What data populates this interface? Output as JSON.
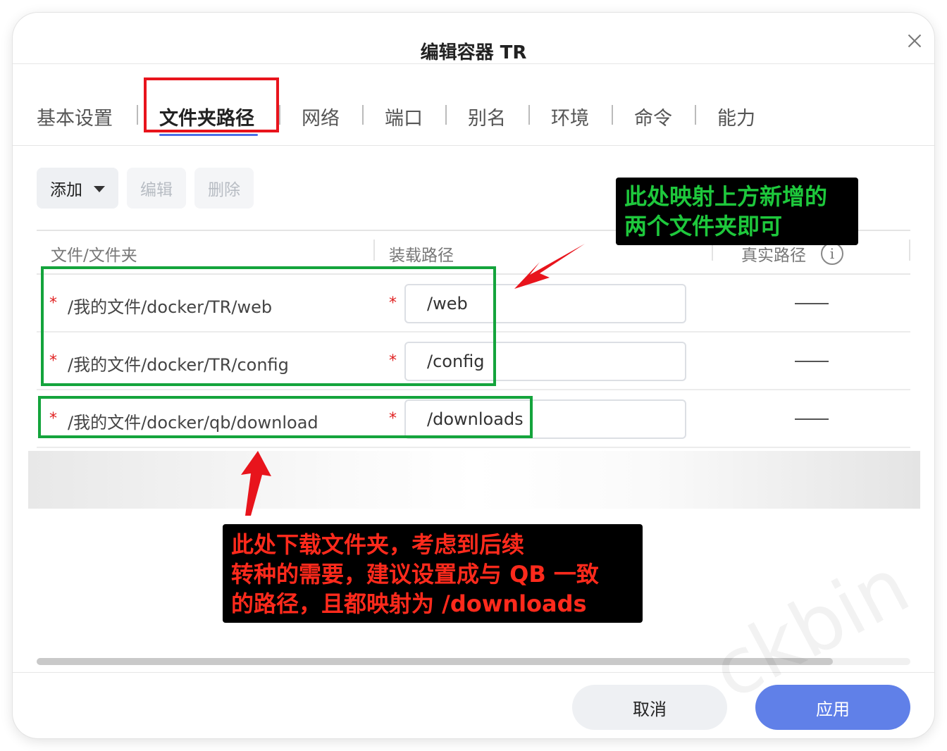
{
  "dialog": {
    "title": "编辑容器 TR"
  },
  "tabs": [
    {
      "label": "基本设置"
    },
    {
      "label": "文件夹路径"
    },
    {
      "label": "网络"
    },
    {
      "label": "端口"
    },
    {
      "label": "别名"
    },
    {
      "label": "环境"
    },
    {
      "label": "命令"
    },
    {
      "label": "能力"
    }
  ],
  "toolbar": {
    "add_label": "添加",
    "edit_label": "编辑",
    "delete_label": "删除"
  },
  "table": {
    "headers": {
      "source": "文件/文件夹",
      "mount": "装载路径",
      "real": "真实路径"
    },
    "info_icon": "i",
    "required_mark": "*",
    "rows": [
      {
        "source": "/我的文件/docker/TR/web",
        "mount": "/web"
      },
      {
        "source": "/我的文件/docker/TR/config",
        "mount": "/config"
      },
      {
        "source": "/我的文件/docker/qb/download",
        "mount": "/downloads"
      }
    ]
  },
  "footer": {
    "cancel_label": "取消",
    "apply_label": "应用"
  },
  "annotations": {
    "green_note": "此处映射上方新增的\n两个文件夹即可",
    "red_note": "此处下载文件夹，考虑到后续\n转种的需要，建议设置成与 QB 一致\n的路径，且都映射为 /downloads"
  },
  "watermark": "ckbin",
  "colors": {
    "accent": "#6080e8",
    "tab_underline": "#4c6ee8",
    "required": "#e02020",
    "annotation_red": "#e8141c",
    "annotation_green": "#14a43c"
  }
}
